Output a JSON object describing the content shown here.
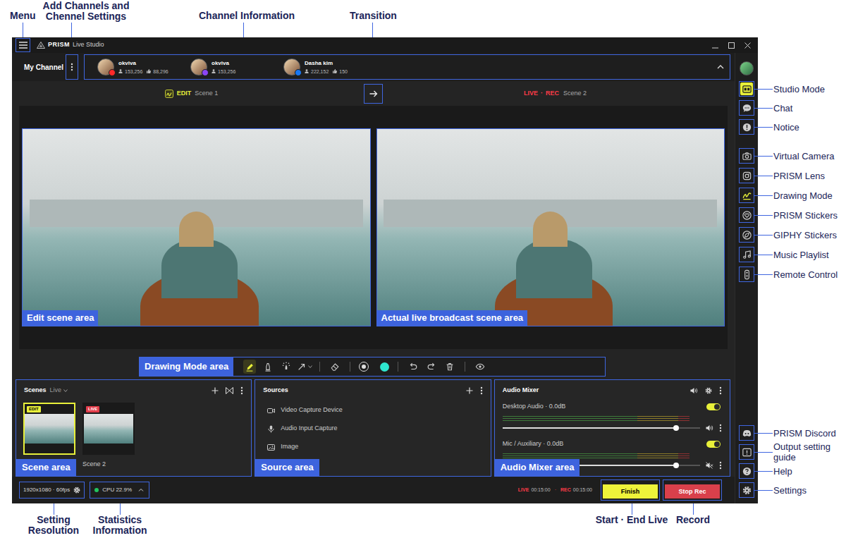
{
  "callouts": {
    "top": [
      {
        "lines": [
          "Menu"
        ]
      },
      {
        "lines": [
          "Add Channels and",
          "Chennel Settings"
        ]
      },
      {
        "lines": [
          "Channel Information"
        ]
      },
      {
        "lines": [
          "Transition"
        ]
      }
    ],
    "bottom": [
      {
        "lines": [
          "Setting",
          "Resolution"
        ]
      },
      {
        "lines": [
          "Statistics",
          "Information"
        ]
      },
      {
        "lines": [
          "Start · End Live"
        ]
      },
      {
        "lines": [
          "Record"
        ]
      }
    ]
  },
  "window": {
    "brand": "PRISM",
    "product": "Live Studio"
  },
  "channel_bar": {
    "title": "My Channel",
    "expanded": true,
    "channels": [
      {
        "name": "okviva",
        "followers": "153,256",
        "likes": "88,296",
        "color": "#ff2a2a"
      },
      {
        "name": "okviva",
        "followers": "153,256",
        "color": "#8b45f5"
      },
      {
        "name": "Dasha kim",
        "followers": "222,152",
        "likes": "150",
        "color": "#1877f2"
      }
    ]
  },
  "scene_header": {
    "edit_badge": "EDIT",
    "edit_scene": "Scene 1",
    "live": "LIVE",
    "separator": "·",
    "rec": "REC",
    "live_scene": "Scene 2"
  },
  "preview": {
    "edit_label": "Edit scene area",
    "live_label": "Actual live broadcast scene area"
  },
  "drawing_toolbar": {
    "label": "Drawing Mode area",
    "tools": [
      {
        "kind": "pen",
        "selected": true
      },
      {
        "kind": "marker",
        "selected": false
      },
      {
        "kind": "glow",
        "selected": false
      },
      {
        "kind": "arrow",
        "selected": false
      },
      {
        "kind": "eraser",
        "selected": false
      }
    ],
    "color": "#2ee6cf",
    "actions": [
      {
        "kind": "undo"
      },
      {
        "kind": "redo"
      },
      {
        "kind": "clear"
      },
      {
        "kind": "visibility"
      }
    ]
  },
  "scenes": {
    "title": "Scenes",
    "mode": "Live",
    "area_label": "Scene area",
    "items": [
      {
        "badge": "EDIT",
        "color": "#e8f03a",
        "selected": true
      },
      {
        "badge": "LIVE",
        "name": "Scene 2",
        "color": "#e23d4a",
        "selected": false
      }
    ]
  },
  "sources": {
    "title": "Sources",
    "area_label": "Source area",
    "items": [
      {
        "kind": "video",
        "name": "Video Capture Device"
      },
      {
        "kind": "audio",
        "name": "Audio Input Capture"
      },
      {
        "kind": "image",
        "name": "Image"
      }
    ]
  },
  "audio_mixer": {
    "title": "Audio Mixer",
    "area_label": "Audio Mixer area",
    "channels": [
      {
        "label": "Desktop Audio · 0.0dB",
        "on": true,
        "level": 0.88,
        "muted": false
      },
      {
        "label": "Mic / Auxiliary · 0.0dB",
        "on": true,
        "level": 0.88,
        "muted": true
      }
    ]
  },
  "status_bar": {
    "resolution": "1920x1080 · 60fps",
    "cpu": "CPU 22.9%",
    "cpu_color": "#22c55e",
    "live": "LIVE",
    "live_time": "00:15:00",
    "separator": "·",
    "rec": "REC",
    "rec_time": "00:15:00",
    "finish": "Finish",
    "stop_rec": "Stop Rec"
  },
  "sidebar": {
    "top": [
      {
        "kind": "studio",
        "label": [
          "Studio Mode"
        ],
        "on": true
      },
      {
        "kind": "chat",
        "label": [
          "Chat"
        ],
        "on": false
      },
      {
        "kind": "notice",
        "label": [
          "Notice"
        ],
        "on": false
      }
    ],
    "middle": [
      {
        "kind": "camera",
        "label": [
          "Virtual Camera"
        ],
        "on": false
      },
      {
        "kind": "lens",
        "label": [
          "PRISM Lens"
        ],
        "on": false
      },
      {
        "kind": "drawing",
        "label": [
          "Drawing Mode"
        ],
        "on": false
      },
      {
        "kind": "stickers",
        "label": [
          "PRISM Stickers"
        ],
        "on": false
      },
      {
        "kind": "giphy",
        "label": [
          "GIPHY Stickers"
        ],
        "on": false
      },
      {
        "kind": "music",
        "label": [
          "Music Playlist"
        ],
        "on": false
      },
      {
        "kind": "remote",
        "label": [
          "Remote Control"
        ],
        "on": false
      }
    ],
    "bottom": [
      {
        "kind": "discord",
        "label": [
          "PRISM Discord"
        ],
        "on": false
      },
      {
        "kind": "guide",
        "label": [
          "Output setting",
          "guide"
        ],
        "on": false
      },
      {
        "kind": "help",
        "label": [
          "Help"
        ],
        "on": false
      },
      {
        "kind": "settings",
        "label": [
          "Settings"
        ],
        "on": false
      }
    ]
  }
}
